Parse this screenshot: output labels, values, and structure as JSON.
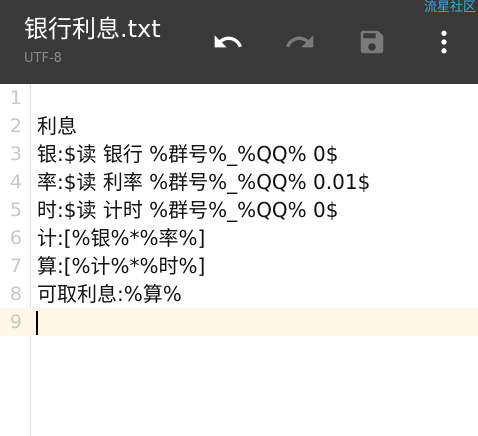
{
  "watermark": "流星社区",
  "file": {
    "title": "银行利息.txt",
    "encoding": "UTF-8"
  },
  "toolbar": {
    "undo_icon": "undo-icon",
    "redo_icon": "redo-icon",
    "save_icon": "save-icon",
    "more_icon": "more-vertical-icon"
  },
  "colors": {
    "toolbar_bg": "#393939",
    "current_line_bg": "#fff8e6",
    "line_number": "#c8c8c8",
    "watermark": "#3fa9d6"
  },
  "editor": {
    "current_line": 9,
    "lines": [
      {
        "num": "1",
        "text": ""
      },
      {
        "num": "2",
        "text": "利息"
      },
      {
        "num": "3",
        "text": "银:$读 银行 %群号%_%QQ% 0$"
      },
      {
        "num": "4",
        "text": "率:$读 利率 %群号%_%QQ% 0.01$"
      },
      {
        "num": "5",
        "text": "时:$读 计时 %群号%_%QQ% 0$"
      },
      {
        "num": "6",
        "text": "计:[%银%*%率%]"
      },
      {
        "num": "7",
        "text": "算:[%计%*%时%]"
      },
      {
        "num": "8",
        "text": "可取利息:%算%"
      },
      {
        "num": "9",
        "text": ""
      }
    ]
  }
}
